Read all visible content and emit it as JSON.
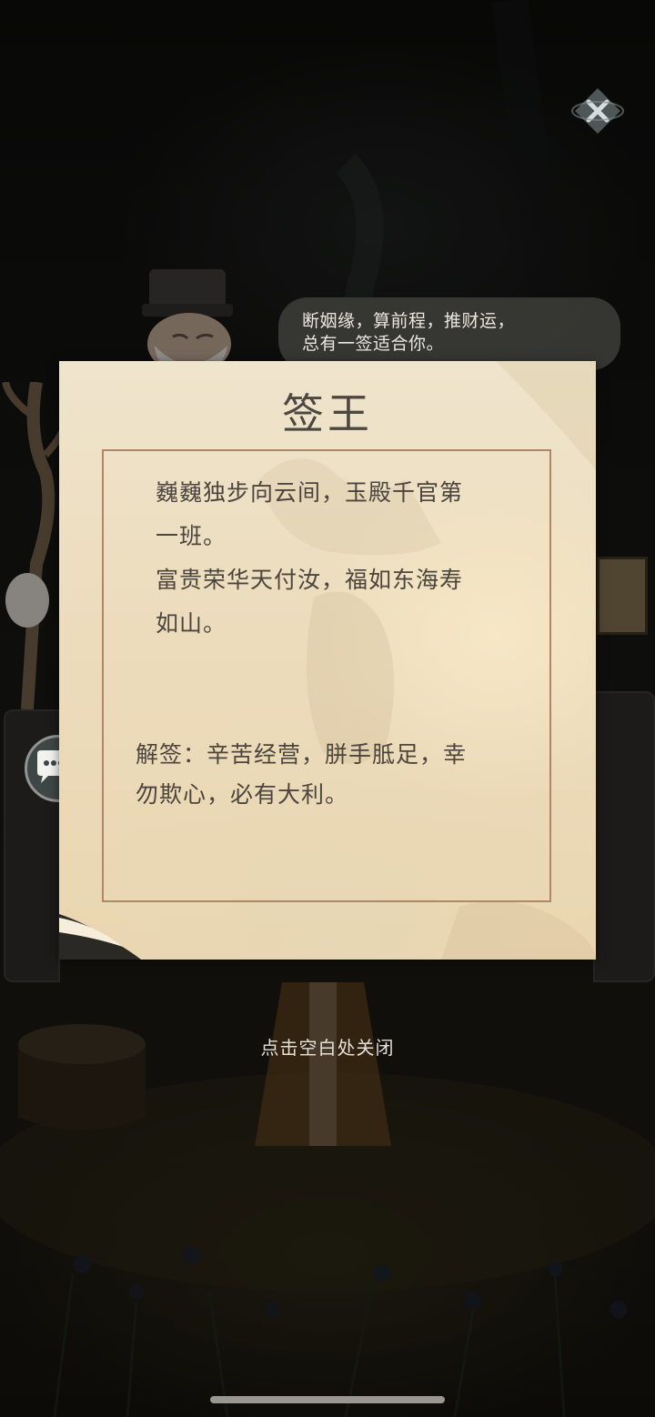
{
  "speech_bubble": {
    "line1": "断姻缘，算前程，推财运，",
    "line2": "总有一签适合你。"
  },
  "fortune_card": {
    "title": "签王",
    "poem_lines": [
      "巍巍独步向云间，玉殿千官第",
      "一班。",
      "富贵荣华天付汝，福如东海寿",
      "如山。"
    ],
    "interpretation_lines": [
      "解签：辛苦经营，胼手胝足，幸",
      "勿欺心，必有大利。"
    ]
  },
  "close_hint": "点击空白处关闭",
  "icons": {
    "close": "close-x-icon",
    "chat": "chat-bubble-gourd-icon"
  },
  "colors": {
    "paper": "#ecdcbc",
    "frame_border": "#b48467",
    "text": "#4c453e",
    "bubble_bg": "#3a3a36"
  }
}
